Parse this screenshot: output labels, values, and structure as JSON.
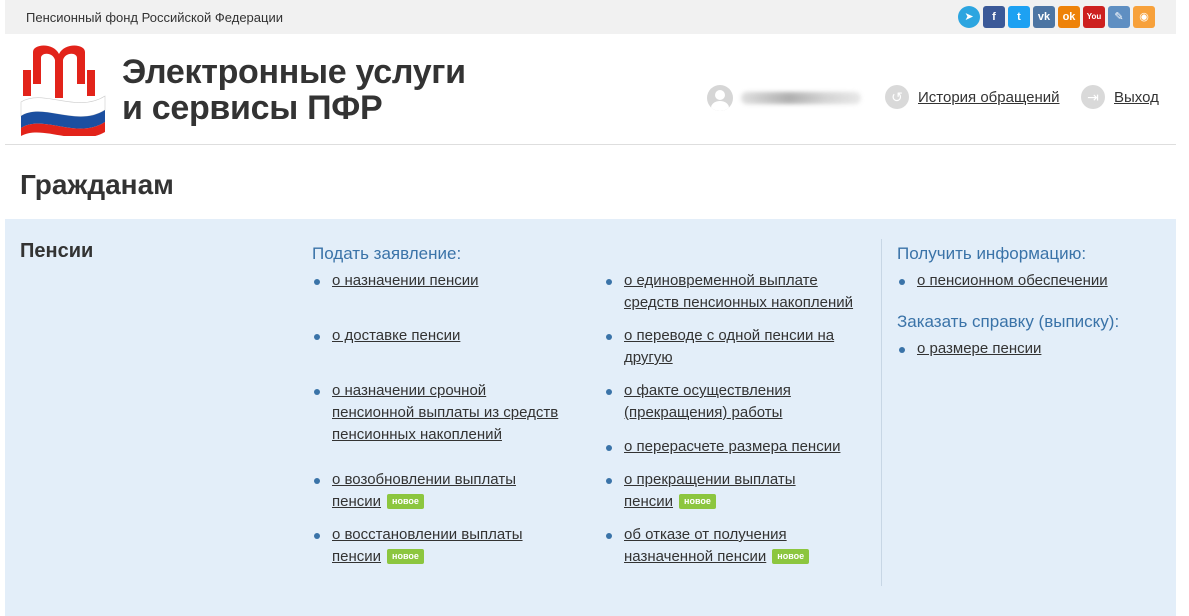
{
  "topbar": {
    "org_name": "Пенсионный фонд Российской Федерации",
    "social": [
      {
        "name": "telegram-icon",
        "glyph": "➤",
        "color": "#2ca5e0"
      },
      {
        "name": "facebook-icon",
        "glyph": "f",
        "color": "#3b5998"
      },
      {
        "name": "twitter-icon",
        "glyph": "t",
        "color": "#1da1f2"
      },
      {
        "name": "vk-icon",
        "glyph": "vk",
        "color": "#4c75a3"
      },
      {
        "name": "odnoklassniki-icon",
        "glyph": "ok",
        "color": "#ee8208"
      },
      {
        "name": "youtube-icon",
        "glyph": "You",
        "color": "#cd201f"
      },
      {
        "name": "livejournal-icon",
        "glyph": "✎",
        "color": "#5f8fc2"
      },
      {
        "name": "rss-icon",
        "glyph": "◉",
        "color": "#f7a13b"
      }
    ]
  },
  "header": {
    "title_line1": "Электронные услуги",
    "title_line2": "и сервисы ПФР",
    "history_link": "История обращений",
    "logout_link": "Выход"
  },
  "page": {
    "title": "Гражданам"
  },
  "pensions": {
    "section_title": "Пенсии",
    "apply_heading": "Подать заявление:",
    "apply_col1": [
      {
        "lines": [
          "о назначении пенсии"
        ],
        "badge": ""
      },
      {
        "lines": [
          "о доставке пенсии"
        ],
        "badge": ""
      },
      {
        "lines": [
          "о назначении срочной",
          "пенсионной выплаты из средств",
          "пенсионных накоплений"
        ],
        "badge": ""
      },
      {
        "lines": [
          "о возобновлении выплаты",
          "пенсии"
        ],
        "badge": "новое"
      },
      {
        "lines": [
          "о восстановлении выплаты",
          "пенсии"
        ],
        "badge": "новое"
      }
    ],
    "apply_col2": [
      {
        "lines": [
          "о единовременной выплате",
          "средств пенсионных накоплений"
        ],
        "badge": ""
      },
      {
        "lines": [
          "о переводе с одной пенсии на",
          "другую"
        ],
        "badge": ""
      },
      {
        "lines": [
          "о факте осуществления",
          "(прекращения) работы"
        ],
        "badge": ""
      },
      {
        "lines": [
          "о перерасчете размера пенсии"
        ],
        "badge": ""
      },
      {
        "lines": [
          "о прекращении выплаты",
          "пенсии"
        ],
        "badge": "новое"
      },
      {
        "lines": [
          "об отказе от получения",
          "назначенной пенсии"
        ],
        "badge": "новое"
      }
    ],
    "info_heading": "Получить информацию:",
    "info_items": [
      {
        "lines": [
          "о пенсионном обеспечении"
        ],
        "badge": ""
      }
    ],
    "order_heading": "Заказать справку (выписку):",
    "order_items": [
      {
        "lines": [
          "о размере пенсии"
        ],
        "badge": ""
      }
    ]
  },
  "colors": {
    "accent": "#3a73a8",
    "panel_bg": "#e3eef9",
    "badge_bg": "#8cc63f"
  }
}
